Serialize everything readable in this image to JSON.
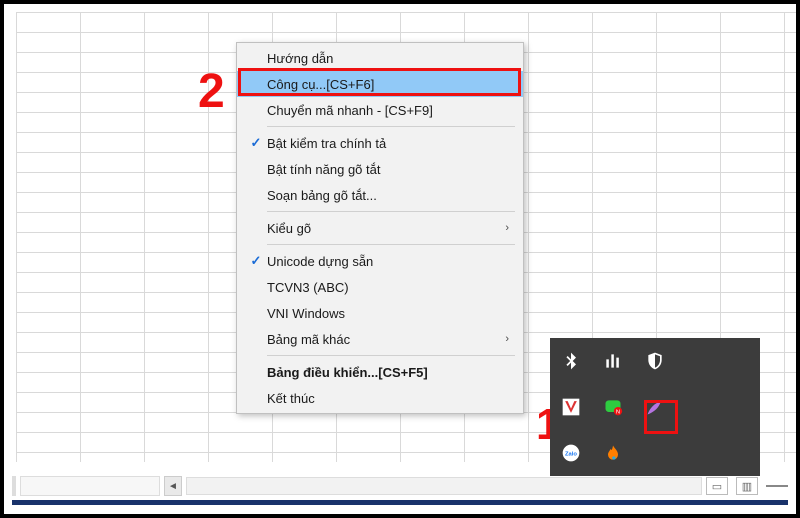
{
  "annotations": {
    "step1": "1",
    "step2": "2"
  },
  "menu": {
    "items": [
      {
        "label": "Hướng dẫn",
        "checked": false,
        "submenu": false,
        "bold": false,
        "highlight": false
      },
      {
        "label": "Công cụ...[CS+F6]",
        "checked": false,
        "submenu": false,
        "bold": false,
        "highlight": true
      },
      {
        "label": "Chuyển mã nhanh - [CS+F9]",
        "checked": false,
        "submenu": false,
        "bold": false,
        "highlight": false
      },
      {
        "sep": true
      },
      {
        "label": "Bật kiểm tra chính tả",
        "checked": true,
        "submenu": false,
        "bold": false,
        "highlight": false
      },
      {
        "label": "Bật tính năng gõ tắt",
        "checked": false,
        "submenu": false,
        "bold": false,
        "highlight": false
      },
      {
        "label": "Soạn bảng gõ tắt...",
        "checked": false,
        "submenu": false,
        "bold": false,
        "highlight": false
      },
      {
        "sep": true
      },
      {
        "label": "Kiểu gõ",
        "checked": false,
        "submenu": true,
        "bold": false,
        "highlight": false
      },
      {
        "sep": true
      },
      {
        "label": "Unicode dựng sẵn",
        "checked": true,
        "submenu": false,
        "bold": false,
        "highlight": false
      },
      {
        "label": "TCVN3 (ABC)",
        "checked": false,
        "submenu": false,
        "bold": false,
        "highlight": false
      },
      {
        "label": "VNI Windows",
        "checked": false,
        "submenu": false,
        "bold": false,
        "highlight": false
      },
      {
        "label": "Bảng mã khác",
        "checked": false,
        "submenu": true,
        "bold": false,
        "highlight": false
      },
      {
        "sep": true
      },
      {
        "label": "Bảng điều khiển...[CS+F5]",
        "checked": false,
        "submenu": false,
        "bold": true,
        "highlight": false
      },
      {
        "label": "Kết thúc",
        "checked": false,
        "submenu": false,
        "bold": false,
        "highlight": false
      }
    ]
  },
  "tray": {
    "icons": [
      "bluetooth-icon",
      "equalizer-icon",
      "shield-icon",
      "blank",
      "blank",
      "unikey-icon",
      "chat-icon",
      "pen-icon",
      "blank",
      "blank",
      "zalo-icon",
      "flame-icon",
      "blank",
      "blank",
      "blank"
    ]
  },
  "colors": {
    "highlight": "#91c9f7",
    "callout": "#e11e1e",
    "tray_bg": "#3c3c3c"
  }
}
